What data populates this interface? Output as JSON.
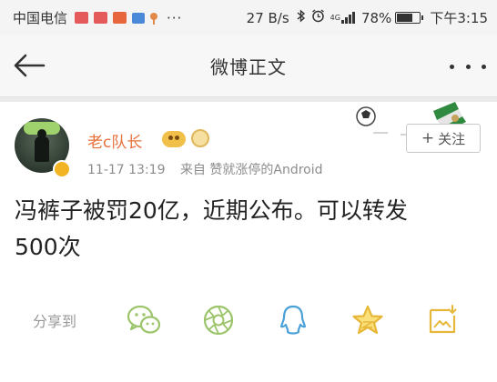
{
  "status_bar": {
    "carrier": "中国电信",
    "more": "···",
    "speed": "27 B/s",
    "bluetooth_icon": "bluetooth-icon",
    "alarm_icon": "alarm-icon",
    "network_label": "4G",
    "battery_pct": "78%",
    "battery_level": 0.78,
    "time": "下午3:15"
  },
  "nav": {
    "title": "微博正文"
  },
  "post": {
    "username": "老c队长",
    "timestamp": "11-17 13:19",
    "source": "来自 赞就涨停的Android",
    "follow_label": "关注",
    "text_lines": [
      "冯裤子被罚20亿，近期公布。可以转发",
      "500次"
    ]
  },
  "share": {
    "label": "分享到",
    "targets": [
      "wechat-icon",
      "moments-icon",
      "qq-icon",
      "qzone-icon",
      "save-image-icon"
    ]
  },
  "colors": {
    "username": "#e8703a",
    "share_green": "#9cc46a",
    "share_blue": "#4aa0d8",
    "share_gold": "#e7b73a"
  }
}
